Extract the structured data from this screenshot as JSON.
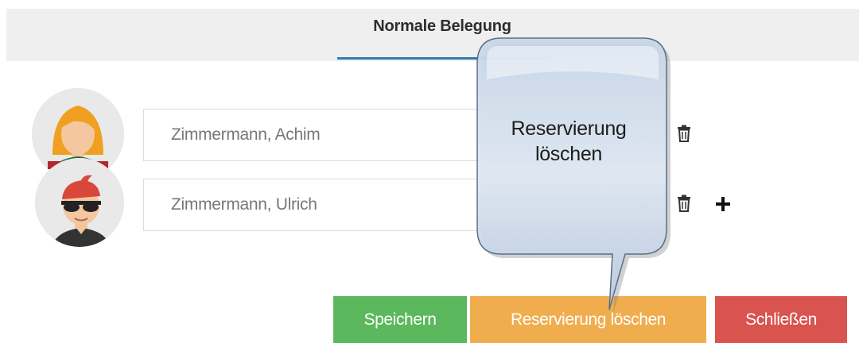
{
  "tab": {
    "label": "Normale Belegung"
  },
  "guests": [
    {
      "name": "Zimmermann, Achim"
    },
    {
      "name": "Zimmermann, Ulrich"
    }
  ],
  "buttons": {
    "save": "Speichern",
    "delete_reservation": "Reservierung löschen",
    "close": "Schließen"
  },
  "tooltip": {
    "text": "Reservierung löschen"
  },
  "colors": {
    "tab_accent": "#337ab7",
    "save": "#5cb85c",
    "delete": "#f0ad4e",
    "close": "#d9534f"
  },
  "icons": [
    "female-avatar-icon",
    "male-avatar-icon",
    "chevron-down-icon",
    "trash-icon",
    "plus-icon"
  ]
}
